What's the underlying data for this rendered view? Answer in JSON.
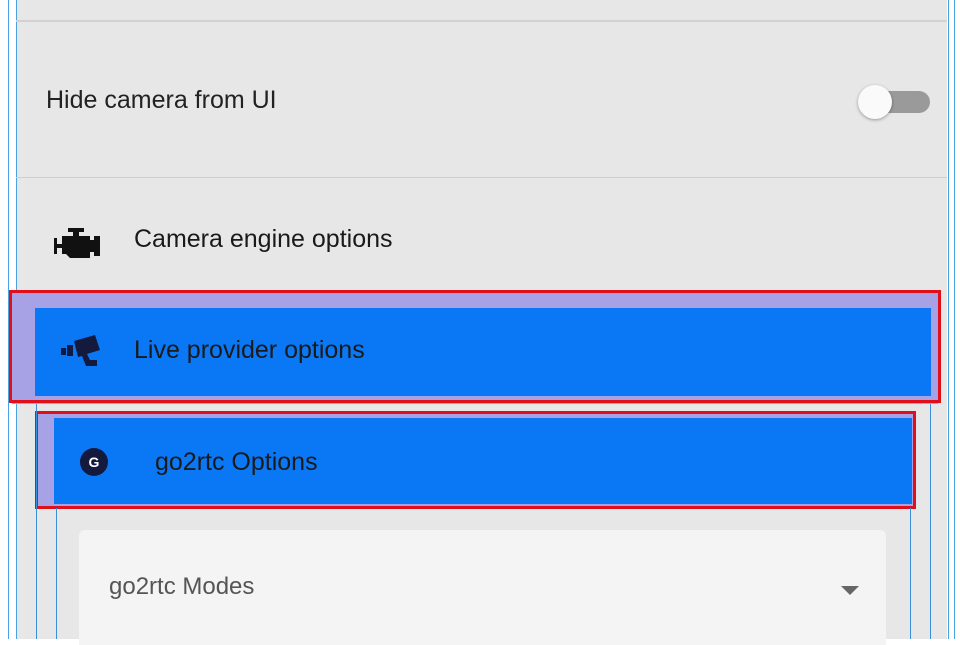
{
  "settings": {
    "hide_camera": {
      "label": "Hide camera from UI",
      "enabled": false
    },
    "sections": {
      "camera_engine": {
        "label": "Camera engine options",
        "icon": "engine-icon"
      },
      "live_provider": {
        "label": "Live provider options",
        "icon": "cctv-camera-icon"
      },
      "go2rtc": {
        "label": "go2rtc Options",
        "icon": "go2rtc-logo-icon",
        "icon_letter": "G"
      }
    },
    "go2rtc_modes": {
      "label": "go2rtc Modes",
      "icon": "chevron-down-icon"
    }
  },
  "colors": {
    "panel": "#e7e7e7",
    "highlight": "#0a78f5",
    "highlight_band": "#a7a2e6",
    "outline": "#e0101a",
    "guide_line": "#4aa3e0"
  }
}
